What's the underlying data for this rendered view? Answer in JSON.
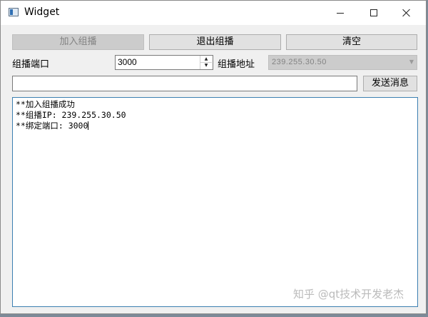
{
  "window": {
    "title": "Widget"
  },
  "toolbar": {
    "join_label": "加入组播",
    "leave_label": "退出组播",
    "clear_label": "清空"
  },
  "port": {
    "label": "组播端口",
    "value": "3000"
  },
  "address": {
    "label": "组播地址",
    "value": "239.255.30.50"
  },
  "message": {
    "value": "",
    "send_label": "发送消息"
  },
  "log": {
    "lines": [
      "**加入组播成功",
      "**组播IP: 239.255.30.50",
      "**绑定端口: 3000"
    ]
  },
  "watermark": "知乎 @qt技术开发老杰",
  "colors": {
    "window_bg": "#f0f0f0",
    "focus_border": "#3c7fb1",
    "disabled_bg": "#cccccc"
  }
}
